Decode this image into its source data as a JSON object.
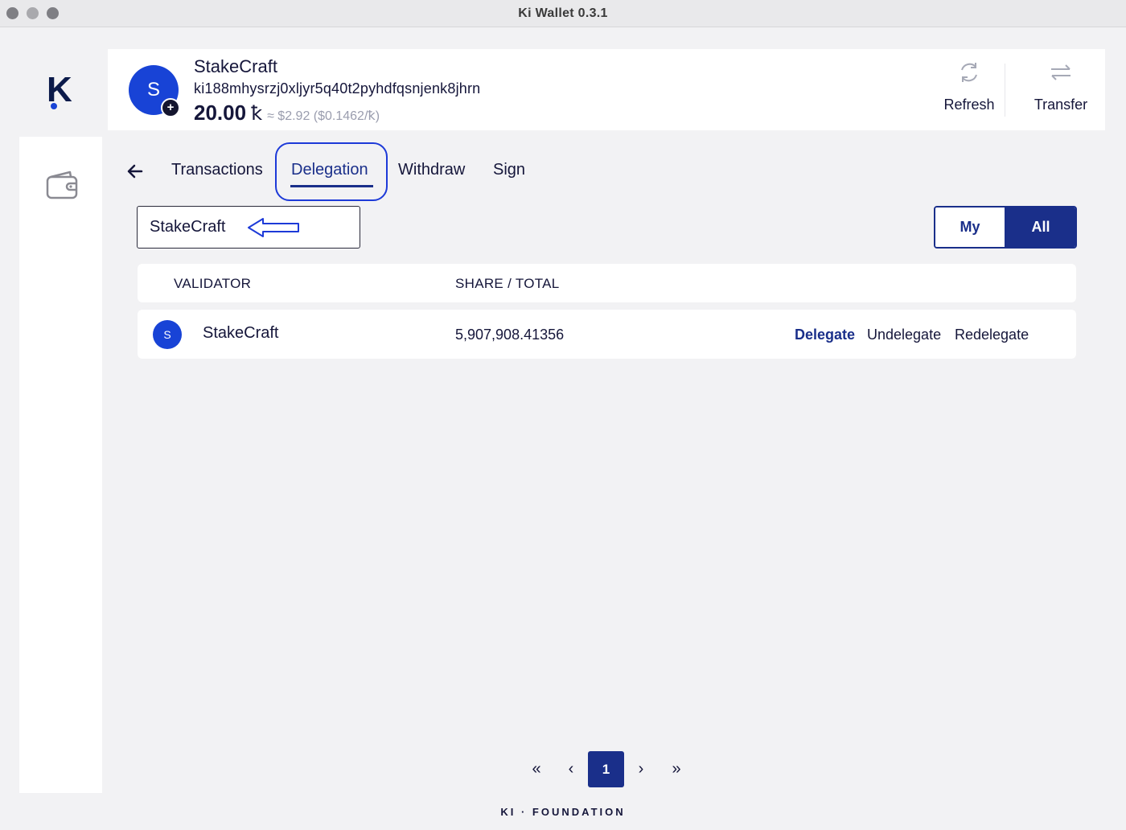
{
  "window": {
    "title": "Ki Wallet 0.3.1"
  },
  "brand": {
    "logo_letter": "K",
    "footer": "KI · FOUNDATION"
  },
  "account": {
    "avatar_letter": "S",
    "badge": "+",
    "name": "StakeCraft",
    "address": "ki188mhysrzj0xljyr5q40t2pyhdfqsnjenk8jhrn",
    "balance": "20.00",
    "balance_symbol": "ꝁ",
    "usd_value": "≈ $2.92 ($0.1462/ꝁ)"
  },
  "header_actions": {
    "refresh": "Refresh",
    "transfer": "Transfer"
  },
  "tabs": [
    {
      "label": "Transactions"
    },
    {
      "label": "Delegation",
      "active": true
    },
    {
      "label": "Withdraw"
    },
    {
      "label": "Sign"
    }
  ],
  "search": {
    "value": "StakeCraft"
  },
  "filter": {
    "my": "My",
    "all": "All",
    "selected": "All"
  },
  "table": {
    "columns": [
      "VALIDATOR",
      "SHARE / TOTAL"
    ],
    "rows": [
      {
        "avatar_letter": "S",
        "validator": "StakeCraft",
        "share": "5,907,908.41356",
        "actions": [
          "Delegate",
          "Undelegate",
          "Redelegate"
        ]
      }
    ]
  },
  "pagination": {
    "first": "«",
    "prev": "‹",
    "current": "1",
    "next": "›",
    "last": "»"
  },
  "colors": {
    "primary": "#1a2f8a",
    "accent": "#1843d6",
    "highlight_annotation": "#1d3ad8",
    "background": "#f2f2f4"
  },
  "icons": {
    "sidebar": "wallet-icon",
    "refresh": "refresh-icon",
    "transfer": "transfer-icon",
    "back": "back-arrow-icon",
    "annotation": "arrow-annotation-icon"
  }
}
